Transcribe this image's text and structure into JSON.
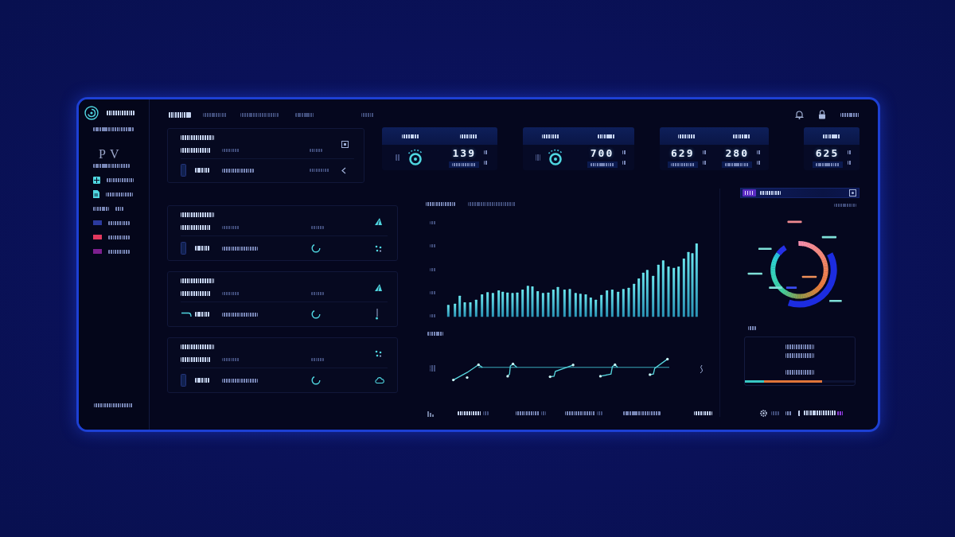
{
  "sidebar": {
    "title": "PV",
    "legend": [
      {
        "color": "#2b3a9e"
      },
      {
        "color": "#e2385e"
      },
      {
        "color": "#7d1f8f"
      }
    ]
  },
  "nav_tabs": [
    {
      "selected": true
    },
    {
      "selected": false
    },
    {
      "selected": false
    },
    {
      "selected": false
    },
    {
      "selected": false
    }
  ],
  "stat_cards": [
    {
      "cells": [
        {
          "kind": "gauge"
        },
        {
          "kind": "number",
          "value": "139"
        }
      ]
    },
    {
      "cells": [
        {
          "kind": "gauge"
        },
        {
          "kind": "number",
          "value": "700"
        }
      ]
    },
    {
      "cells": [
        {
          "kind": "number",
          "value": "629"
        },
        {
          "kind": "number",
          "value": "280"
        }
      ]
    },
    {
      "cells": [
        {
          "kind": "number",
          "value": "625"
        }
      ]
    }
  ],
  "summary_box": {
    "level": 0.7
  }
}
